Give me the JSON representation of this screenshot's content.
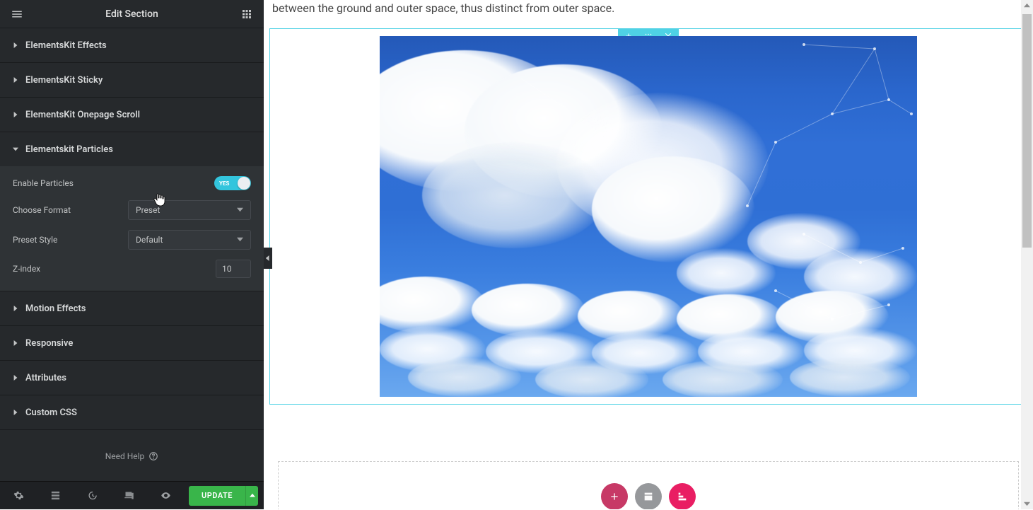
{
  "sidebar": {
    "title": "Edit Section",
    "accordions": {
      "effects": "ElementsKit Effects",
      "sticky": "ElementsKit Sticky",
      "onepage": "ElementsKit Onepage Scroll",
      "particles": "Elementskit Particles",
      "motion": "Motion Effects",
      "responsive": "Responsive",
      "attributes": "Attributes",
      "custom_css": "Custom CSS"
    },
    "particles": {
      "enable_label": "Enable Particles",
      "enable_on_text": "YES",
      "format_label": "Choose Format",
      "format_value": "Preset",
      "style_label": "Preset Style",
      "style_value": "Default",
      "zindex_label": "Z-index",
      "zindex_value": "10"
    },
    "help_text": "Need Help",
    "update_label": "UPDATE"
  },
  "canvas": {
    "intro_text": "between the ground and outer space, thus distinct from outer space."
  }
}
